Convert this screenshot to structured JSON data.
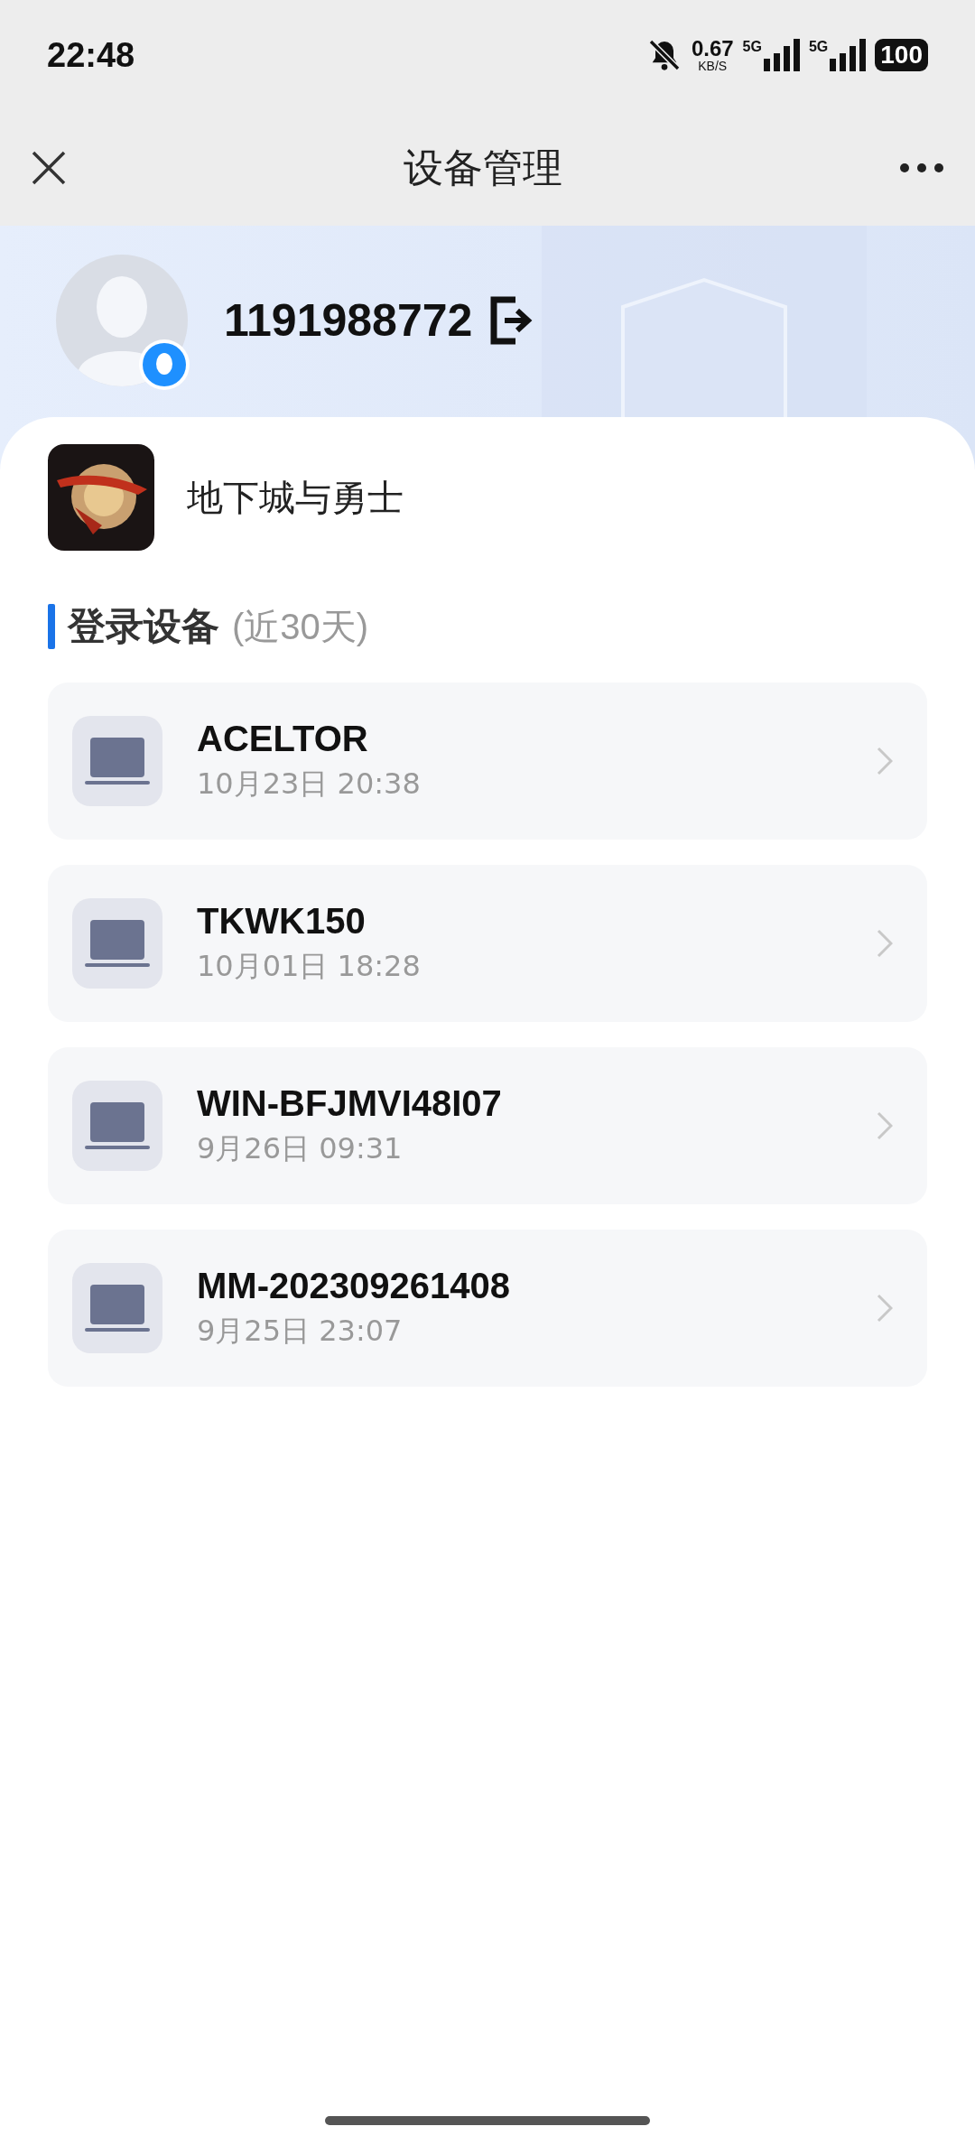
{
  "status_bar": {
    "time": "22:48",
    "net_speed": "0.67",
    "net_unit": "KB/S",
    "sim_1": "5G",
    "sim_2": "5G",
    "battery": "100"
  },
  "nav_bar": {
    "title": "设备管理"
  },
  "account": {
    "id": "1191988772"
  },
  "game": {
    "name": "地下城与勇士"
  },
  "section": {
    "title": "登录设备",
    "subtitle": "(近30天)"
  },
  "devices": [
    {
      "name": "ACELTOR",
      "time": "10月23日 20:38"
    },
    {
      "name": "TKWK150",
      "time": "10月01日 18:28"
    },
    {
      "name": "WIN-BFJMVI48I07",
      "time": "9月26日 09:31"
    },
    {
      "name": "MM-202309261408",
      "time": "9月25日 23:07"
    }
  ]
}
